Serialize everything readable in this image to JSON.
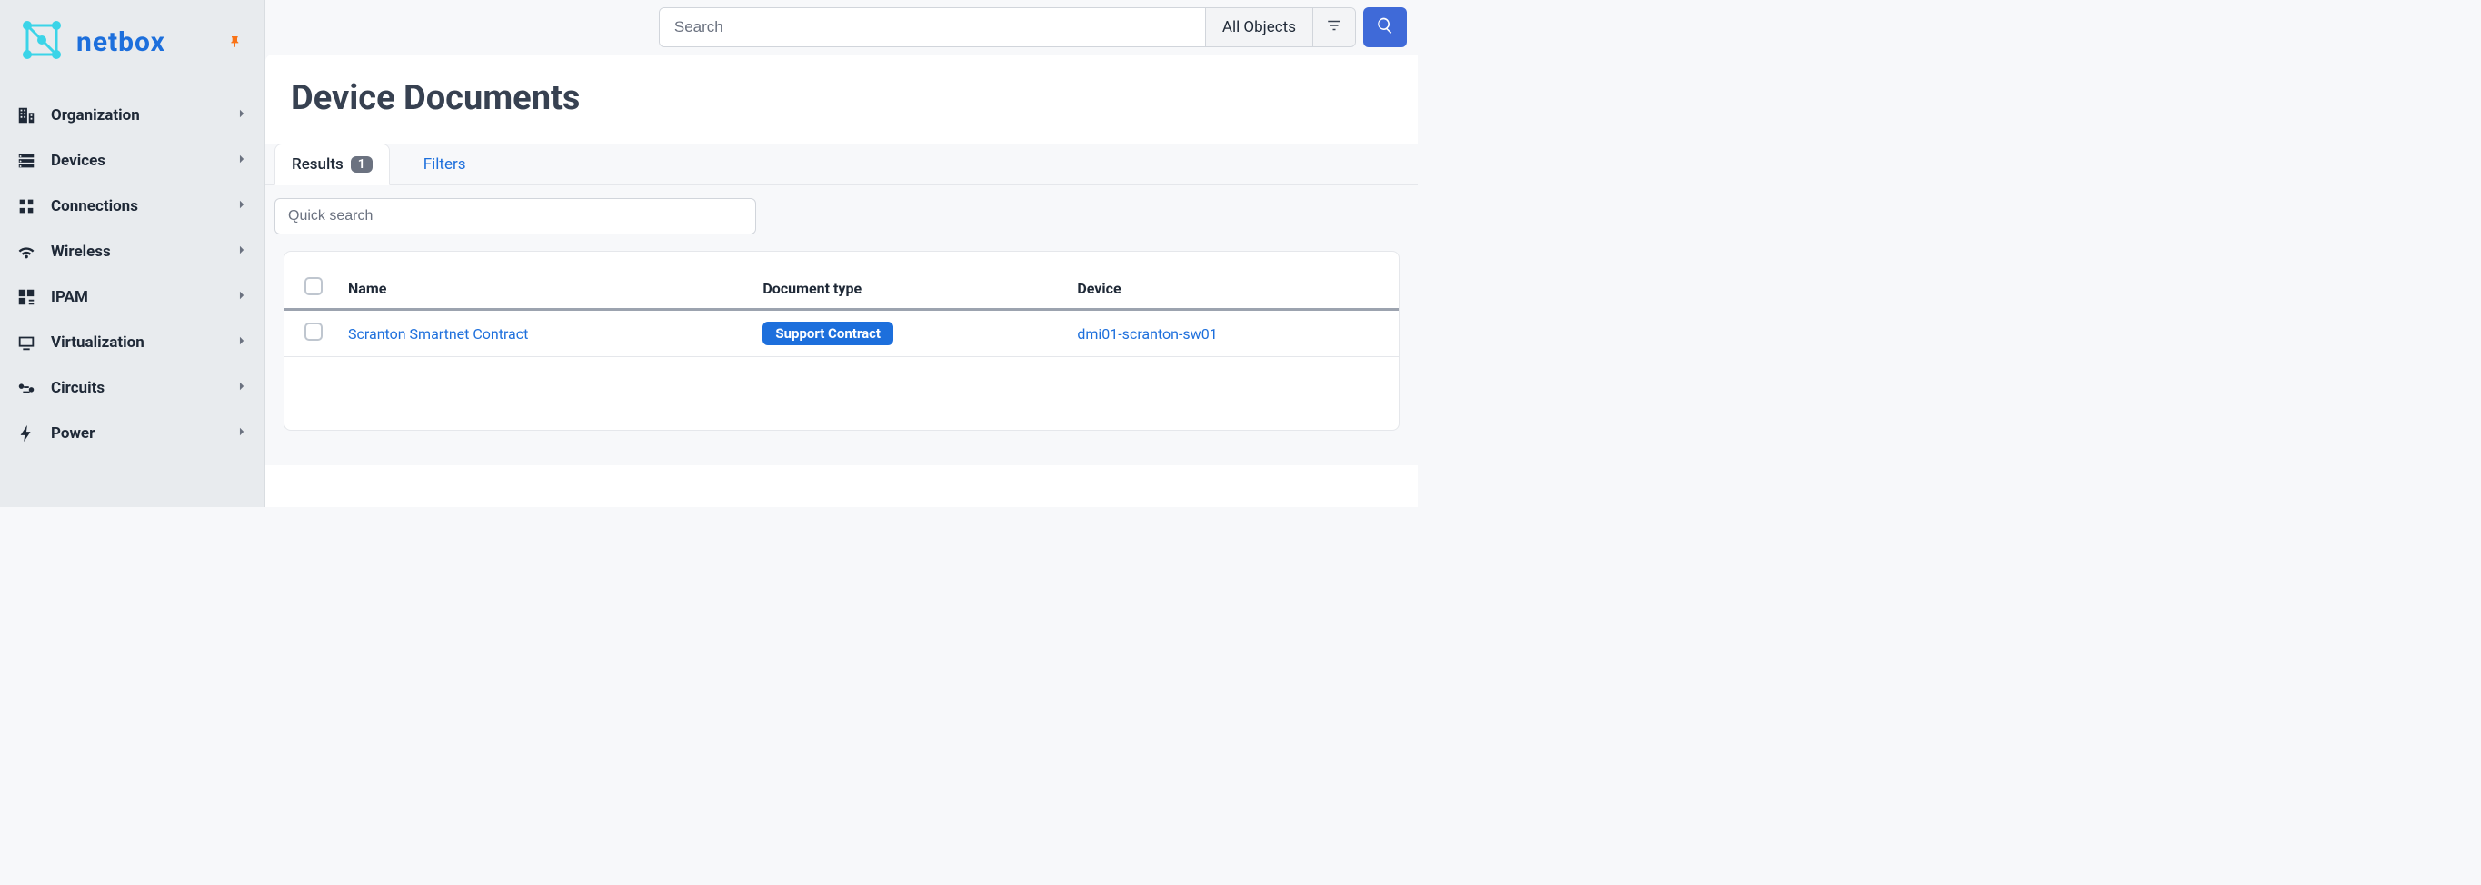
{
  "brand": {
    "name": "netbox"
  },
  "sidebar": {
    "items": [
      {
        "label": "Organization"
      },
      {
        "label": "Devices"
      },
      {
        "label": "Connections"
      },
      {
        "label": "Wireless"
      },
      {
        "label": "IPAM"
      },
      {
        "label": "Virtualization"
      },
      {
        "label": "Circuits"
      },
      {
        "label": "Power"
      }
    ]
  },
  "header": {
    "search_placeholder": "Search",
    "objects_label": "All Objects"
  },
  "page": {
    "title": "Device Documents",
    "tabs": {
      "results_label": "Results",
      "results_count": "1",
      "filters_label": "Filters"
    },
    "quick_search_placeholder": "Quick search",
    "columns": {
      "name": "Name",
      "doctype": "Document type",
      "device": "Device"
    },
    "rows": [
      {
        "name": "Scranton Smartnet Contract",
        "doctype": "Support Contract",
        "device": "dmi01-scranton-sw01"
      }
    ]
  }
}
